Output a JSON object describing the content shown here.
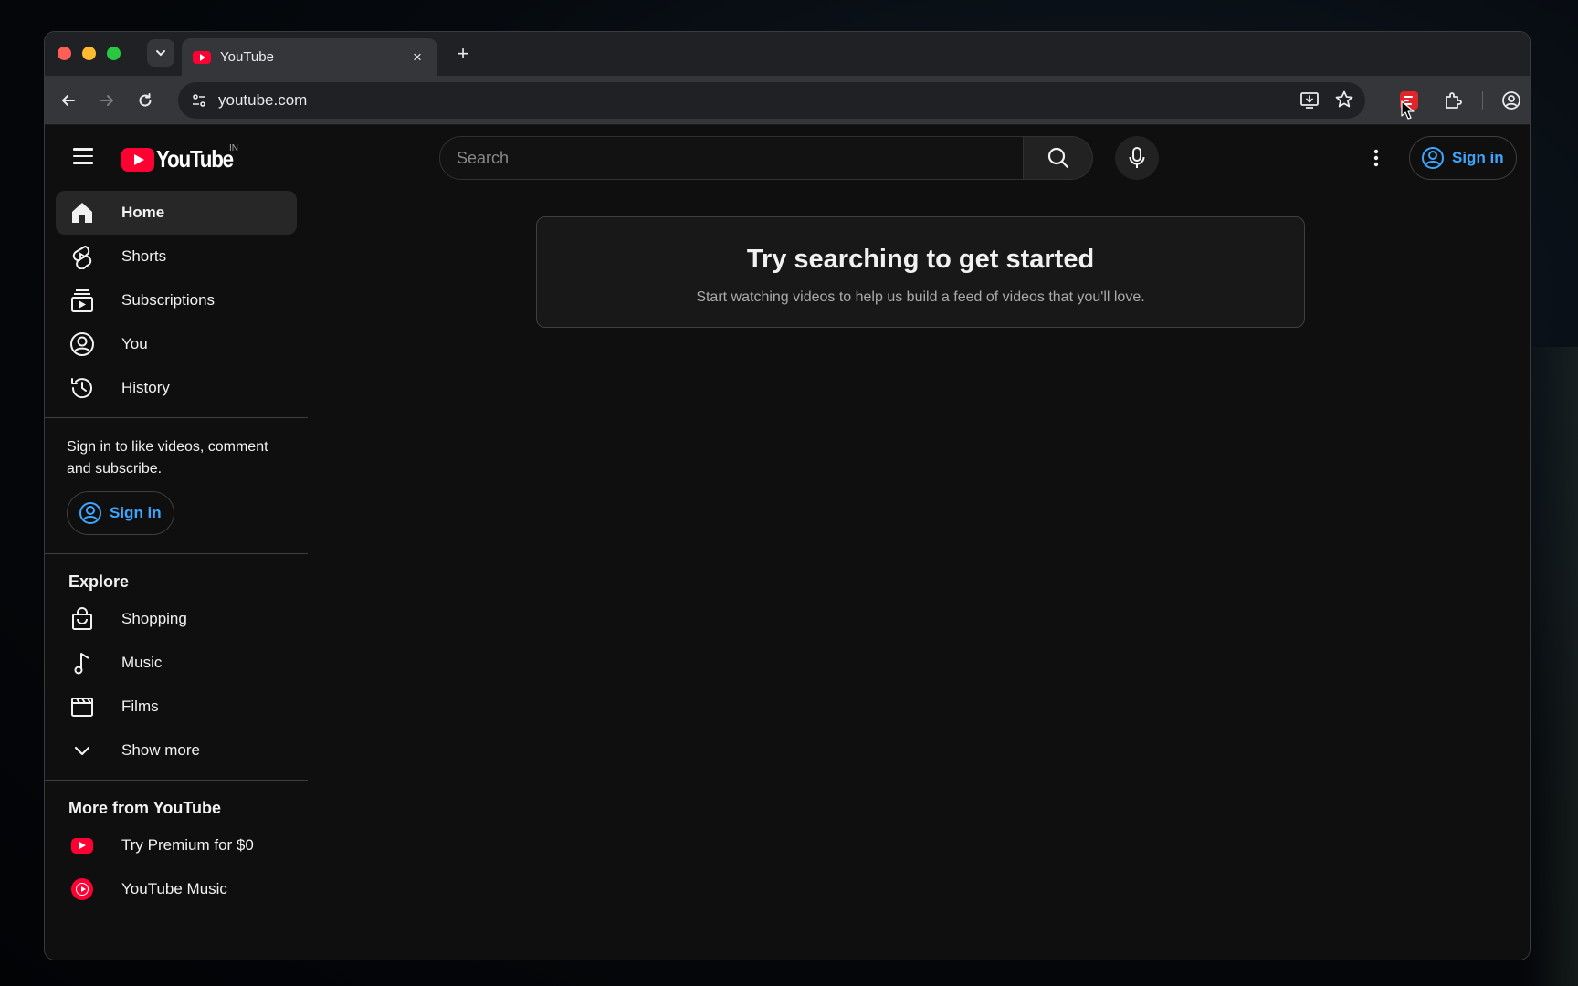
{
  "browser": {
    "tab": {
      "title": "YouTube",
      "close": "×"
    },
    "new_tab": "+",
    "omnibox": {
      "url": "youtube.com"
    }
  },
  "youtube": {
    "logo_text": "YouTube",
    "country": "IN",
    "search": {
      "placeholder": "Search"
    },
    "signin_label": "Sign in",
    "sidebar": {
      "main": [
        {
          "label": "Home",
          "icon": "home-icon",
          "active": true
        },
        {
          "label": "Shorts",
          "icon": "shorts-icon"
        },
        {
          "label": "Subscriptions",
          "icon": "subscriptions-icon"
        },
        {
          "label": "You",
          "icon": "account-icon"
        },
        {
          "label": "History",
          "icon": "history-icon"
        }
      ],
      "signin_prompt": "Sign in to like videos, comment and subscribe.",
      "signin_label": "Sign in",
      "explore_heading": "Explore",
      "explore": [
        {
          "label": "Shopping",
          "icon": "shopping-bag-icon"
        },
        {
          "label": "Music",
          "icon": "music-note-icon"
        },
        {
          "label": "Films",
          "icon": "film-icon"
        },
        {
          "label": "Show more",
          "icon": "chevron-down-icon"
        }
      ],
      "more_heading": "More from YouTube",
      "more": [
        {
          "label": "Try Premium for $0",
          "icon": "youtube-premium-icon"
        },
        {
          "label": "YouTube Music",
          "icon": "youtube-music-icon"
        }
      ]
    },
    "empty_state": {
      "title": "Try searching to get started",
      "subtitle": "Start watching videos to help us build a feed of videos that you'll love."
    },
    "colors": {
      "accent_red": "#ff0033",
      "link_blue": "#3ea6ff",
      "background": "#0f0f0f"
    }
  }
}
